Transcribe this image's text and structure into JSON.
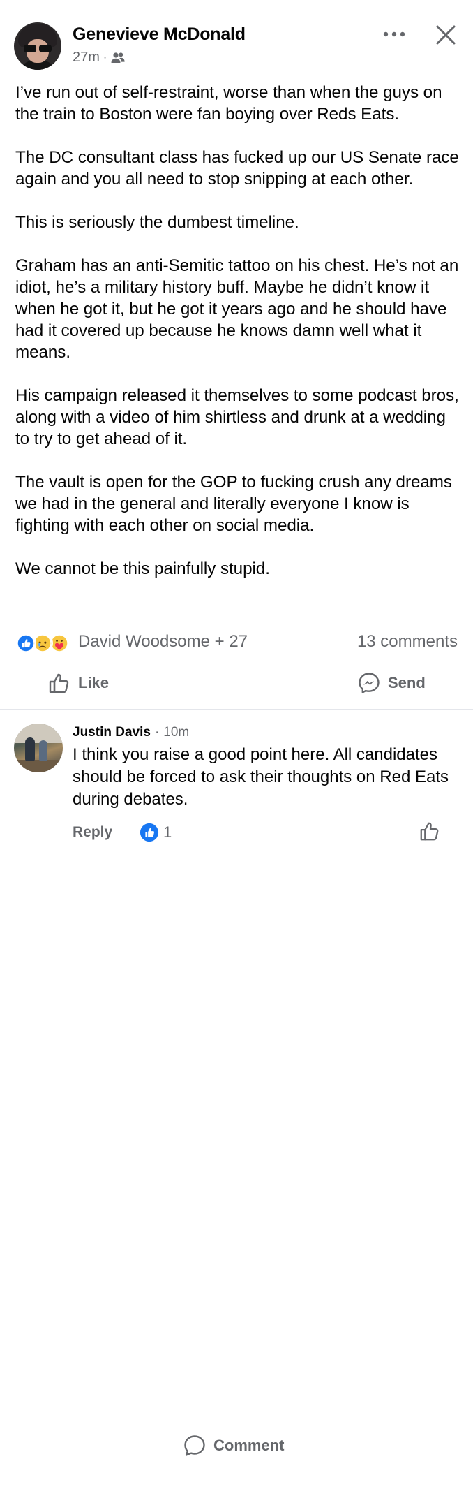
{
  "post": {
    "author": "Genevieve McDonald",
    "time": "27m",
    "separator": "·",
    "audience_icon": "friends-icon",
    "paragraphs": [
      "I’ve run out of self-restraint, worse than when the guys on the train to Boston were fan boying over Reds Eats.",
      "The DC consultant class has fucked up our US Senate race again and you all need to stop snipping at each other.",
      "This is seriously the dumbest timeline.",
      "Graham has an anti-Semitic tattoo on his chest. He’s not an idiot, he’s a military history buff. Maybe he didn’t know it when he got it, but he got it years ago and he should have had it covered up because he knows damn well what it means.",
      "His campaign released it themselves to some podcast bros, along with a video of him shirtless and drunk at a wedding to try to get ahead of it.",
      "The vault is open for the GOP to fucking crush any dreams we had in the general and literally everyone I know is fighting with each other on social media.",
      "We cannot be this painfully stupid."
    ]
  },
  "reactions": {
    "icons": [
      "like-reaction-icon",
      "sad-reaction-icon",
      "care-reaction-icon"
    ],
    "names": "David Woodsome + 27",
    "comments": "13 comments"
  },
  "actions": {
    "like": "Like",
    "comment": "Comment",
    "send": "Send"
  },
  "comment": {
    "author": "Justin Davis",
    "separator": "·",
    "time": "10m",
    "text": "I think you raise a good point here. All candidates should be forced to ask their thoughts on Red Eats during debates.",
    "reply": "Reply",
    "like_count": "1"
  },
  "colors": {
    "text": "#050505",
    "secondary": "#65676b",
    "like_blue": "#1877f2",
    "divider": "#e4e6eb"
  }
}
